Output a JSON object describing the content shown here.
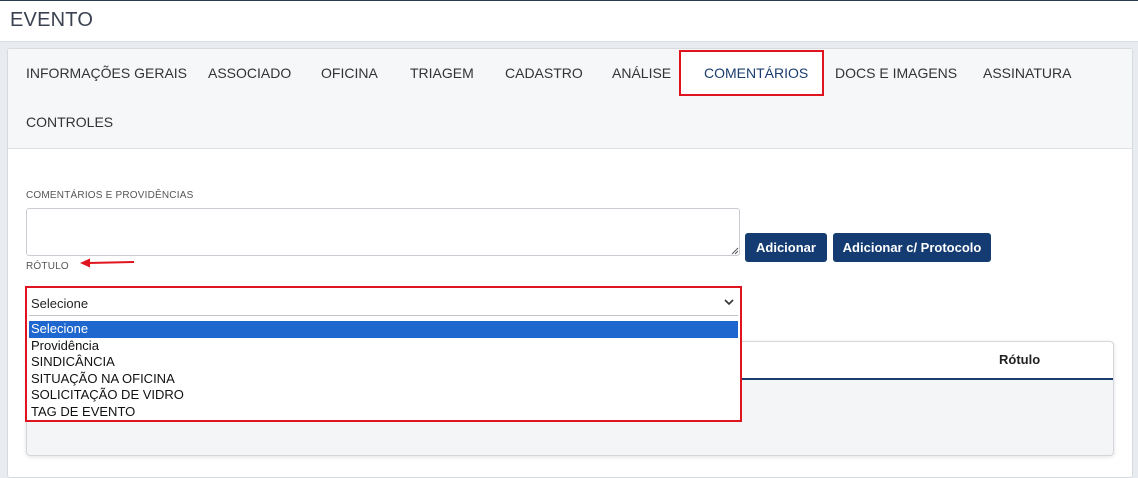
{
  "header": {
    "title": "EVENTO"
  },
  "tabs": [
    {
      "label": "INFORMAÇÕES GERAIS"
    },
    {
      "label": "ASSOCIADO"
    },
    {
      "label": "OFICINA"
    },
    {
      "label": "TRIAGEM"
    },
    {
      "label": "CADASTRO"
    },
    {
      "label": "ANÁLISE"
    },
    {
      "label": "COMENTÁRIOS",
      "active": true
    },
    {
      "label": "DOCS E IMAGENS"
    },
    {
      "label": "ASSINATURA"
    },
    {
      "label": "CONTROLES"
    }
  ],
  "form": {
    "comments_label": "COMENTÁRIOS E PROVIDÊNCIAS",
    "comments_value": "",
    "rotulo_label": "RÓTULO",
    "add_button": "Adicionar",
    "add_protocol_button": "Adicionar c/ Protocolo",
    "select": {
      "selected": "Selecione",
      "options": [
        "Selecione",
        "Providência",
        "SINDICÂNCIA",
        "SITUAÇÃO NA OFICINA",
        "SOLICITAÇÃO DE VIDRO",
        "TAG DE EVENTO"
      ]
    }
  },
  "table": {
    "col_rotulo": "Rótulo"
  },
  "colors": {
    "accent": "#143c72",
    "highlight": "#e0141e",
    "option_selected": "#1e67cf"
  },
  "icons": {
    "dropdown": "chevron-down-icon",
    "annotation": "red-arrow-icon",
    "resize": "resize-grip-icon"
  }
}
